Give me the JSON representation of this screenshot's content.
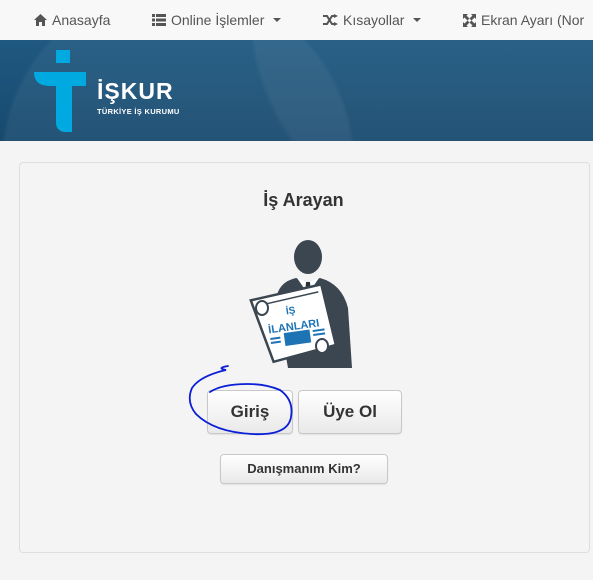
{
  "nav": {
    "items": [
      {
        "label": "Anasayfa",
        "icon": "home-icon"
      },
      {
        "label": "Online İşlemler",
        "icon": "list-icon"
      },
      {
        "label": "Kısayollar",
        "icon": "shuffle-icon"
      },
      {
        "label": "Ekran Ayarı (Nor",
        "icon": "expand-icon"
      }
    ]
  },
  "header": {
    "logo_text": "İŞKUR",
    "logo_subtitle": "TÜRKİYE İŞ KURUMU",
    "brand_color": "#1b4f75",
    "accent_color": "#00a9e0"
  },
  "card": {
    "title": "İş Arayan",
    "newspaper_line1": "İŞ",
    "newspaper_line2": "İLANLARI",
    "login_button": "Giriş",
    "register_button": "Üye Ol",
    "advisor_button": "Danışmanım Kim?"
  },
  "annotation": {
    "color": "#0b1fd6"
  }
}
